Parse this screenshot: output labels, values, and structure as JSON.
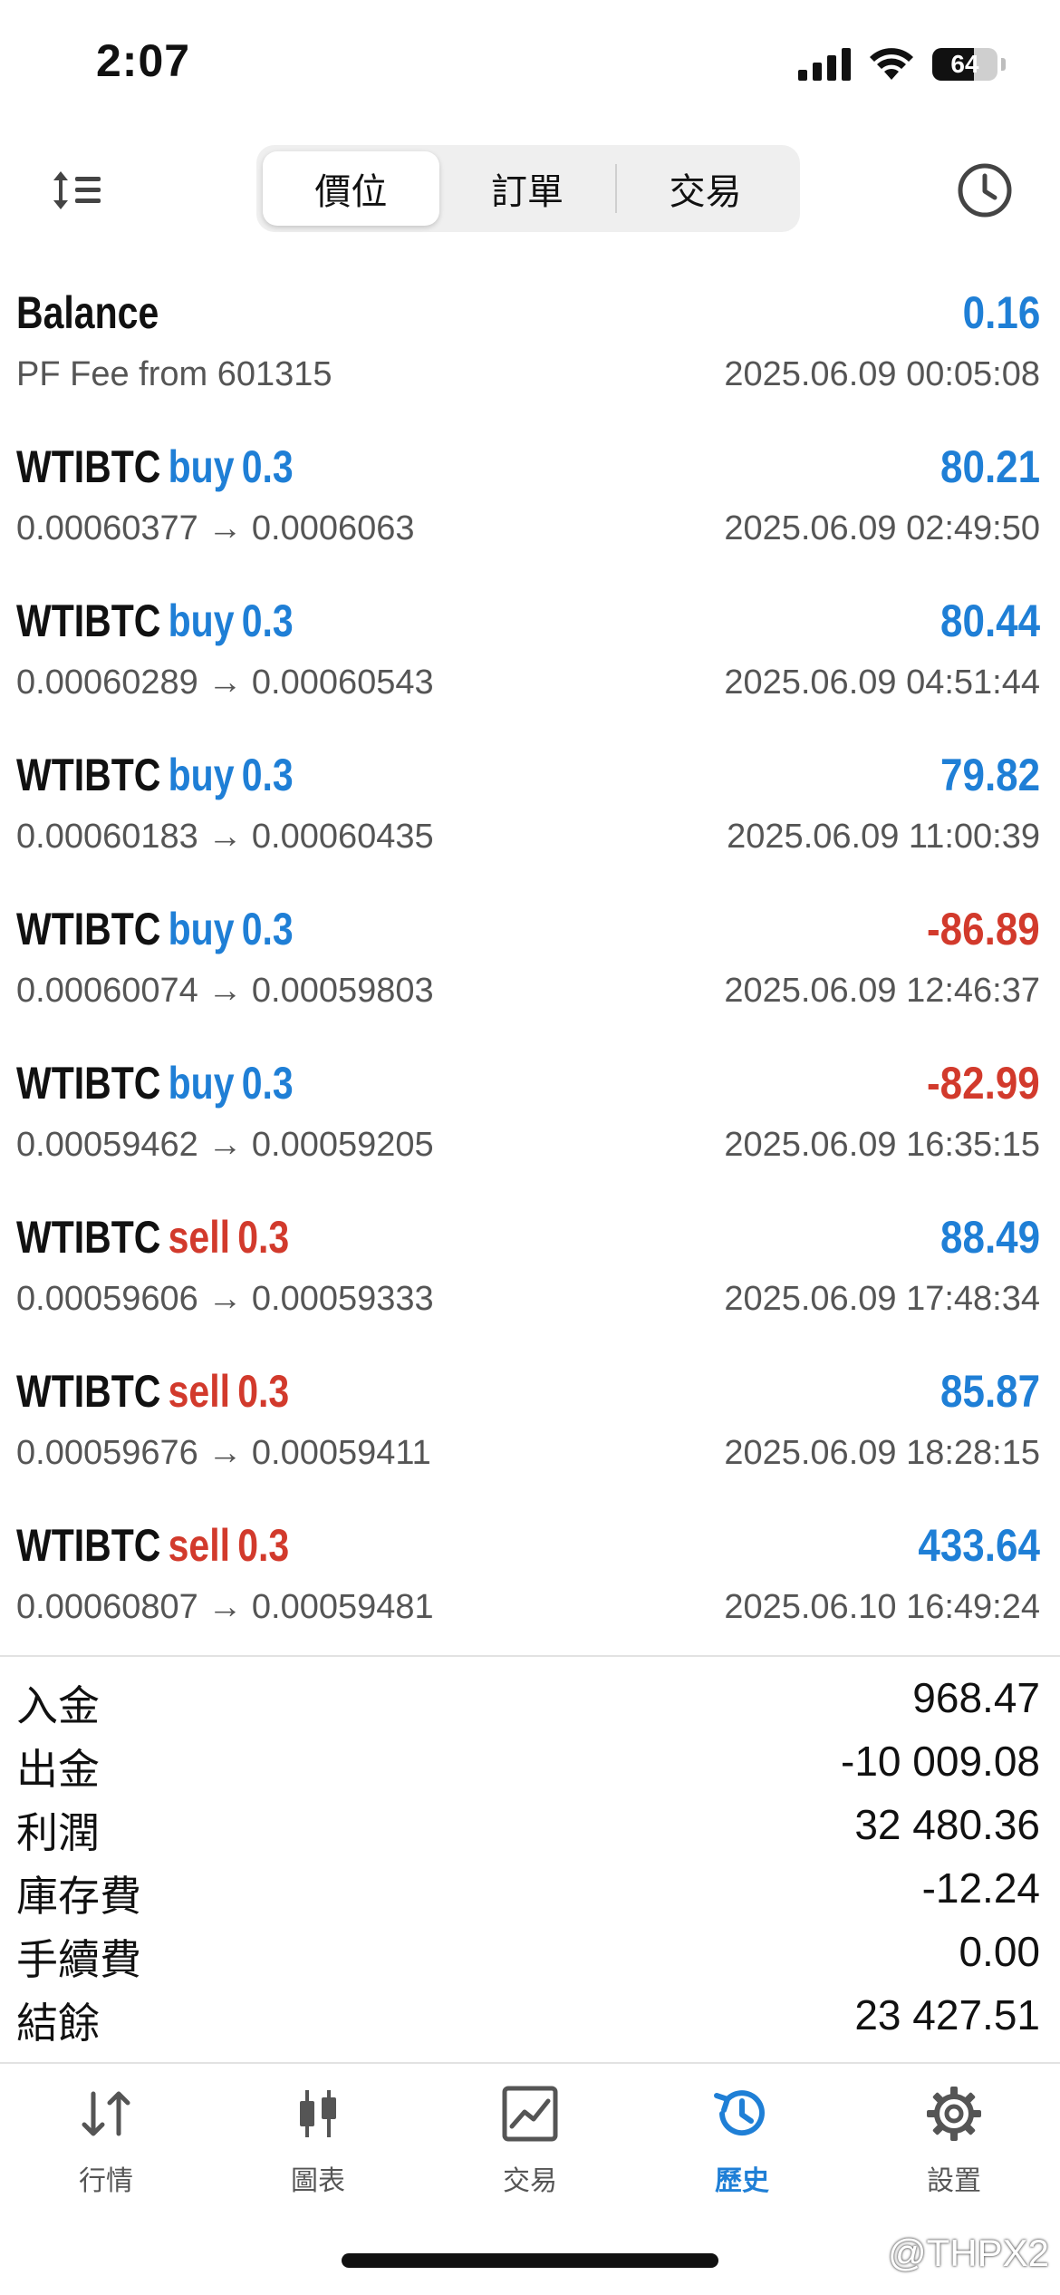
{
  "status_bar": {
    "time": "2:07",
    "battery": "64",
    "battery_level": 0.64
  },
  "toolbar": {
    "segments": [
      {
        "label": "價位",
        "active": true
      },
      {
        "label": "訂單",
        "active": false
      },
      {
        "label": "交易",
        "active": false
      }
    ]
  },
  "history": {
    "balance": {
      "title": "Balance",
      "profit": "0.16",
      "subtitle": "PF Fee from 601315",
      "time": "2025.06.09 00:05:08"
    },
    "deals": [
      {
        "symbol": "WTIBTC",
        "side": "buy",
        "volume": "0.3",
        "profit": "80.21",
        "prices": "0.00060377 → 0.0006063",
        "time": "2025.06.09 02:49:50"
      },
      {
        "symbol": "WTIBTC",
        "side": "buy",
        "volume": "0.3",
        "profit": "80.44",
        "prices": "0.00060289 → 0.00060543",
        "time": "2025.06.09 04:51:44"
      },
      {
        "symbol": "WTIBTC",
        "side": "buy",
        "volume": "0.3",
        "profit": "79.82",
        "prices": "0.00060183 → 0.00060435",
        "time": "2025.06.09 11:00:39"
      },
      {
        "symbol": "WTIBTC",
        "side": "buy",
        "volume": "0.3",
        "profit": "-86.89",
        "prices": "0.00060074 → 0.00059803",
        "time": "2025.06.09 12:46:37"
      },
      {
        "symbol": "WTIBTC",
        "side": "buy",
        "volume": "0.3",
        "profit": "-82.99",
        "prices": "0.00059462 → 0.00059205",
        "time": "2025.06.09 16:35:15"
      },
      {
        "symbol": "WTIBTC",
        "side": "sell",
        "volume": "0.3",
        "profit": "88.49",
        "prices": "0.00059606 → 0.00059333",
        "time": "2025.06.09 17:48:34"
      },
      {
        "symbol": "WTIBTC",
        "side": "sell",
        "volume": "0.3",
        "profit": "85.87",
        "prices": "0.00059676 → 0.00059411",
        "time": "2025.06.09 18:28:15"
      },
      {
        "symbol": "WTIBTC",
        "side": "sell",
        "volume": "0.3",
        "profit": "433.64",
        "prices": "0.00060807 → 0.00059481",
        "time": "2025.06.10 16:49:24"
      }
    ]
  },
  "summary": [
    {
      "label": "入金",
      "value": "968.47"
    },
    {
      "label": "出金",
      "value": "-10 009.08"
    },
    {
      "label": "利潤",
      "value": "32 480.36"
    },
    {
      "label": "庫存費",
      "value": "-12.24"
    },
    {
      "label": "手續費",
      "value": "0.00"
    },
    {
      "label": "結餘",
      "value": "23 427.51"
    }
  ],
  "tabs": [
    {
      "label": "行情",
      "icon": "quotes-arrows-icon",
      "active": false
    },
    {
      "label": "圖表",
      "icon": "candlestick-chart-icon",
      "active": false
    },
    {
      "label": "交易",
      "icon": "trade-chart-icon",
      "active": false
    },
    {
      "label": "歷史",
      "icon": "history-clock-icon",
      "active": true
    },
    {
      "label": "設置",
      "icon": "gear-icon",
      "active": false
    }
  ],
  "watermark": "@THPX2",
  "colors": {
    "accent_blue": "#1f7fd6",
    "loss_red": "#d23a2c",
    "secondary_text": "#555555"
  }
}
